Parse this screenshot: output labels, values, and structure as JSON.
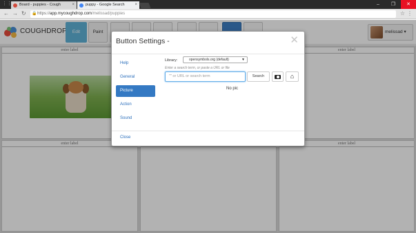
{
  "browser": {
    "tabs": [
      {
        "title": "Board - puppies - Cough",
        "active": true
      },
      {
        "title": "puppy - Google Search",
        "active": false
      }
    ],
    "url_scheme": "https://",
    "url_host": "app.mycoughdrop.com",
    "url_path": "/melissad/puppies"
  },
  "app": {
    "brand": "COUGHDROP",
    "edit_label": "Edit",
    "paint_label": "Paint",
    "user_name": "melissad",
    "user_caret": "▾"
  },
  "board": {
    "cell_label": "enter label"
  },
  "modal": {
    "title": "Button Settings -",
    "close_glyph": "✕",
    "nav": [
      "Help",
      "General",
      "Picture",
      "Action",
      "Sound"
    ],
    "active_nav": "Picture",
    "close_link": "Close",
    "library_label": "Library:",
    "library_value": "opensymbols.org (default)",
    "hint": "Enter a search term, or paste a URL or file",
    "search_placeholder": "\"\" or URL or search term",
    "search_button": "Search",
    "no_pic": "No pic"
  },
  "colors": {
    "accent": "#3479c3",
    "edit_button": "#5fb3d8",
    "link": "#2a6ebb"
  }
}
